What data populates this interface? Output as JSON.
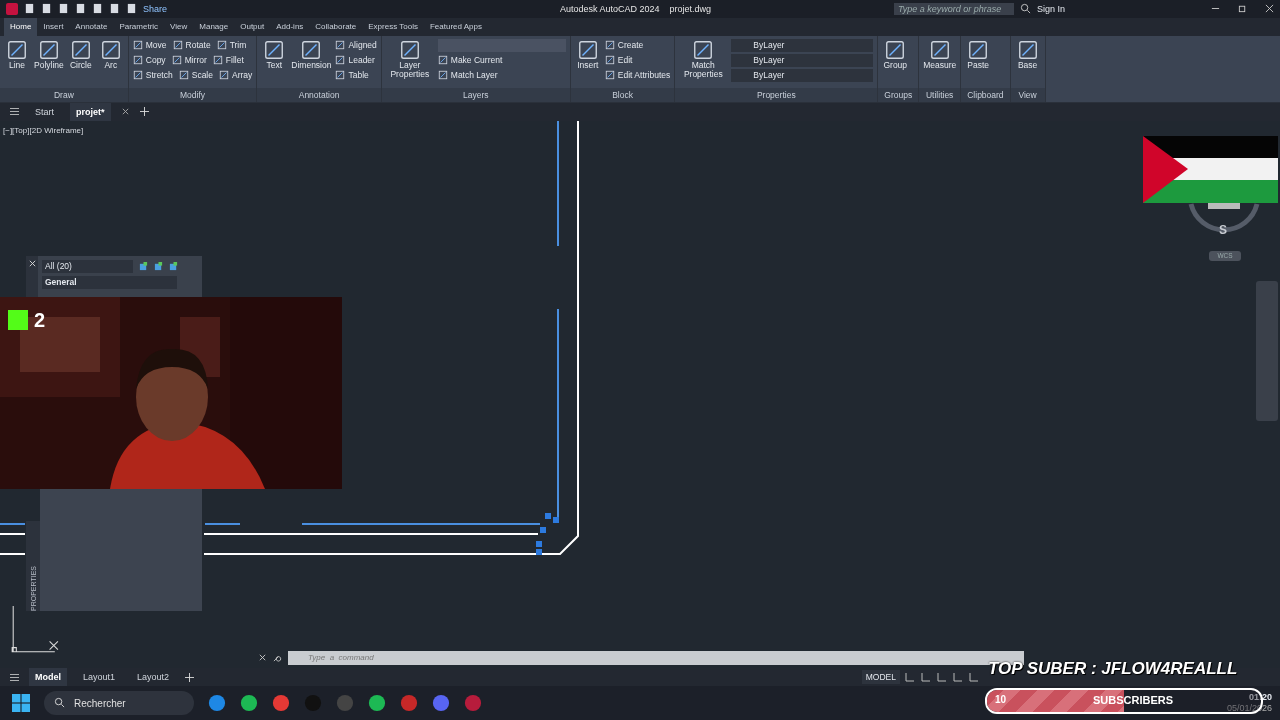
{
  "title_bar": {
    "share": "Share",
    "title": "Autodesk AutoCAD 2024",
    "file": "projet.dwg",
    "search": {
      "placeholder": "Type a keyword or phrase"
    },
    "sign_in": "Sign In"
  },
  "ribbon_tabs": [
    {
      "label": "Home",
      "selected": true
    },
    {
      "label": "Insert",
      "selected": false
    },
    {
      "label": "Annotate",
      "selected": false
    },
    {
      "label": "Parametric",
      "selected": false
    },
    {
      "label": "View",
      "selected": false
    },
    {
      "label": "Manage",
      "selected": false
    },
    {
      "label": "Output",
      "selected": false
    },
    {
      "label": "Add-ins",
      "selected": false
    },
    {
      "label": "Collaborate",
      "selected": false
    },
    {
      "label": "Express Tools",
      "selected": false
    },
    {
      "label": "Featured Apps",
      "selected": false
    }
  ],
  "ribbon_panels": [
    {
      "kind": "tools",
      "title": "Draw",
      "large": [
        "Line",
        "Polyline",
        "Circle",
        "Arc"
      ]
    },
    {
      "kind": "tools",
      "title": "Modify",
      "rows": [
        [
          "Move",
          "Rotate",
          "Trim"
        ],
        [
          "Copy",
          "Mirror",
          "Fillet"
        ],
        [
          "Stretch",
          "Scale",
          "Array"
        ]
      ]
    },
    {
      "kind": "tools",
      "title": "Annotation",
      "large": [
        "Text",
        "Dimension"
      ],
      "rows": [
        [
          "Aligned"
        ],
        [
          "Leader"
        ],
        [
          "Table"
        ]
      ]
    },
    {
      "kind": "layers",
      "title": "Layers",
      "large": [
        "Layer Properties"
      ],
      "rows": [
        [
          "Make Current"
        ],
        [
          "Match Layer"
        ]
      ]
    },
    {
      "kind": "tools",
      "title": "Block",
      "large": [
        "Insert"
      ],
      "rows": [
        [
          "Create"
        ],
        [
          "Edit"
        ],
        [
          "Edit Attributes"
        ]
      ]
    },
    {
      "kind": "properties",
      "title": "Properties",
      "large": [
        "Match Properties"
      ],
      "dropdowns": [
        "ByLayer",
        "ByLayer",
        "ByLayer"
      ]
    },
    {
      "kind": "tools",
      "title": "Groups",
      "large": [
        "Group"
      ]
    },
    {
      "kind": "tools",
      "title": "Utilities",
      "large": [
        "Measure"
      ]
    },
    {
      "kind": "tools",
      "title": "Clipboard",
      "large": [
        "Paste"
      ]
    },
    {
      "kind": "tools",
      "title": "View",
      "large": [
        "Base"
      ]
    }
  ],
  "file_tabs": [
    {
      "label": "Start",
      "selected": false
    },
    {
      "label": "projet*",
      "selected": true
    }
  ],
  "viewport_label": "[−][Top][2D Wireframe]",
  "layer_palette": {
    "filter": "All (20)",
    "layer": "General"
  },
  "webcam": {
    "badge": "2"
  },
  "properties_palette": {
    "title": "PROPERTIES"
  },
  "viewcube": {
    "direction": "S",
    "coordinate_system": "WCS"
  },
  "command_line": {
    "placeholder": "Type  a  command"
  },
  "layout_tabs": [
    {
      "label": "Model",
      "selected": true
    },
    {
      "label": "Layout1",
      "selected": false
    },
    {
      "label": "Layout2",
      "selected": false
    }
  ],
  "status_bar": {
    "mode": "MODEL"
  },
  "stream_overlay": {
    "top_sub": "TOP SUBER : JFLOW4REALLL",
    "goal_count": "10",
    "goal_label": "SUBSCRIBERS",
    "level": 0.5
  },
  "taskbar": {
    "search": {
      "placeholder": "Rechercher"
    },
    "time": "01:20",
    "date": "05/01/2026"
  }
}
